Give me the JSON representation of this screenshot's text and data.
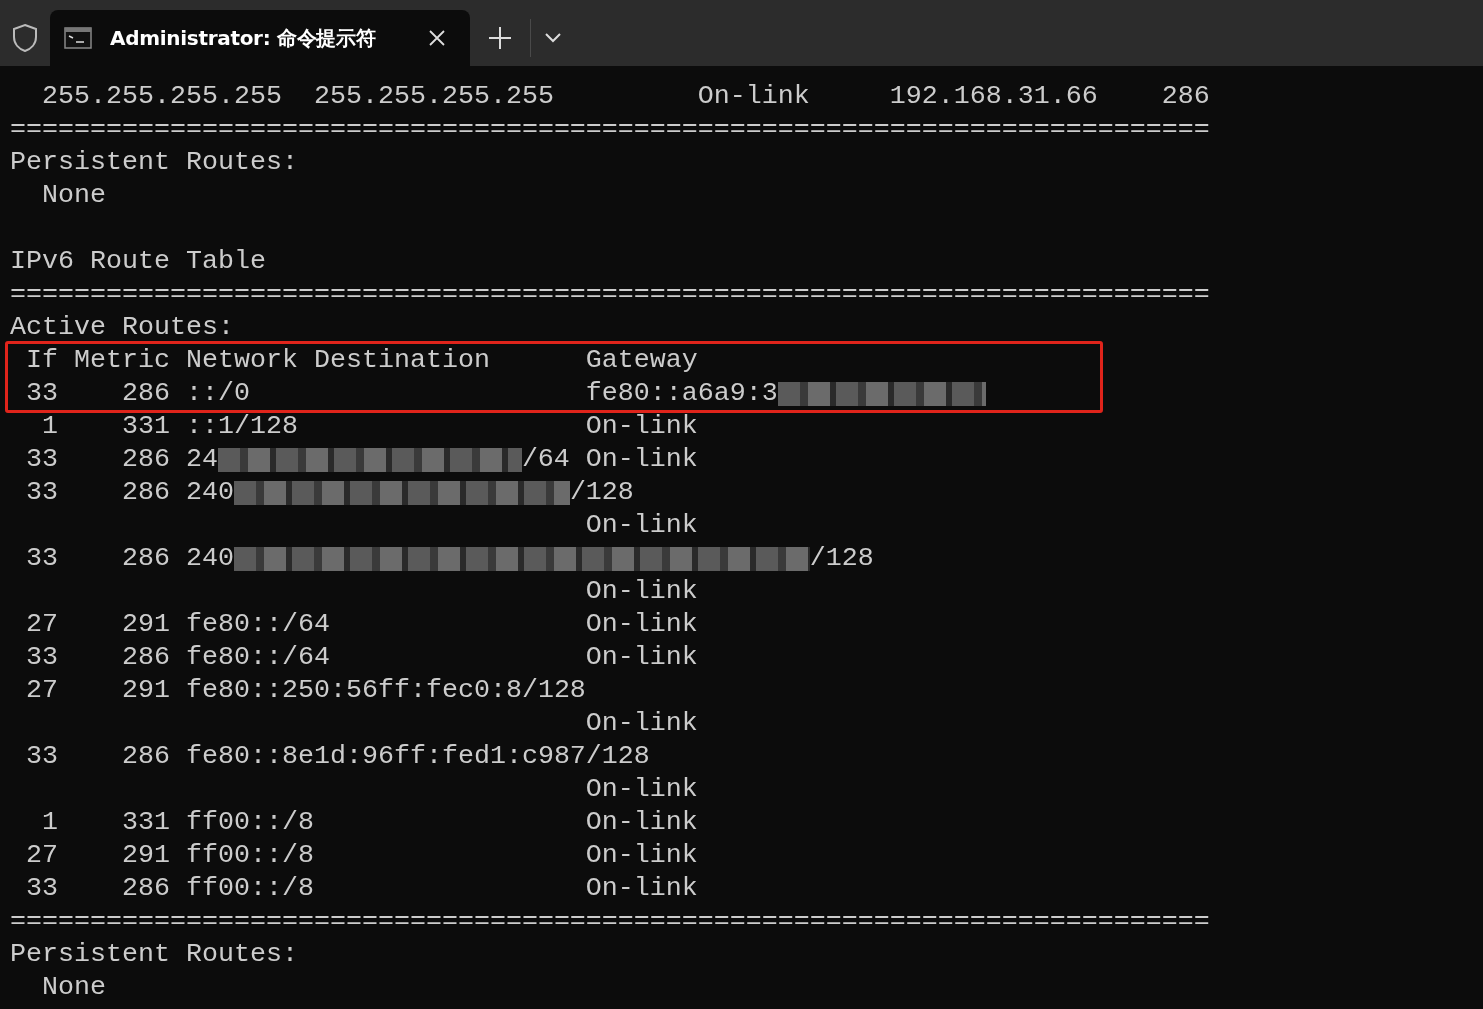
{
  "tab_bar": {
    "tabs": [
      {
        "title": "Administrator: 命令提示符",
        "selected": true
      }
    ]
  },
  "terminal": {
    "blocks": [
      {
        "kind": "plain",
        "lines": [
          {
            "kind": "text",
            "text": "  255.255.255.255  255.255.255.255         On-link     192.168.31.66    286"
          },
          {
            "kind": "text",
            "text": "==========================================================================="
          },
          {
            "kind": "text",
            "text": "Persistent Routes:"
          },
          {
            "kind": "text",
            "text": "  None"
          },
          {
            "kind": "blank"
          },
          {
            "kind": "text",
            "text": "IPv6 Route Table"
          },
          {
            "kind": "text",
            "text": "==========================================================================="
          },
          {
            "kind": "text",
            "text": "Active Routes:"
          }
        ]
      },
      {
        "kind": "highlighted",
        "lines": [
          {
            "kind": "text",
            "text": " If Metric Network Destination      Gateway"
          },
          {
            "kind": "parts",
            "parts": [
              {
                "kind": "text",
                "text": " 33    286 ::/0                     fe80::a6a9:3"
              },
              {
                "kind": "pixelated_short"
              }
            ]
          }
        ]
      },
      {
        "kind": "plain",
        "lines": [
          {
            "kind": "text",
            "text": "  1    331 ::1/128                  On-link"
          },
          {
            "kind": "parts",
            "parts": [
              {
                "kind": "text",
                "text": " 33    286 24"
              },
              {
                "kind": "pixelated_medium"
              },
              {
                "kind": "text",
                "text": "/64 On-link"
              }
            ]
          },
          {
            "kind": "parts",
            "parts": [
              {
                "kind": "text",
                "text": " 33    286 240"
              },
              {
                "kind": "pixelated_long"
              },
              {
                "kind": "text",
                "text": "/128"
              }
            ]
          },
          {
            "kind": "text",
            "text": "                                    On-link"
          },
          {
            "kind": "parts",
            "parts": [
              {
                "kind": "text",
                "text": " 33    286 240"
              },
              {
                "kind": "pixelated_extra_long"
              },
              {
                "kind": "text",
                "text": "/128"
              }
            ]
          },
          {
            "kind": "text",
            "text": "                                    On-link"
          },
          {
            "kind": "text",
            "text": " 27    291 fe80::/64                On-link"
          },
          {
            "kind": "text",
            "text": " 33    286 fe80::/64                On-link"
          },
          {
            "kind": "text",
            "text": " 27    291 fe80::250:56ff:fec0:8/128"
          },
          {
            "kind": "text",
            "text": "                                    On-link"
          },
          {
            "kind": "text",
            "text": " 33    286 fe80::8e1d:96ff:fed1:c987/128"
          },
          {
            "kind": "text",
            "text": "                                    On-link"
          },
          {
            "kind": "text",
            "text": "  1    331 ff00::/8                 On-link"
          },
          {
            "kind": "text",
            "text": " 27    291 ff00::/8                 On-link"
          },
          {
            "kind": "text",
            "text": " 33    286 ff00::/8                 On-link"
          },
          {
            "kind": "text",
            "text": "==========================================================================="
          },
          {
            "kind": "text",
            "text": "Persistent Routes:"
          },
          {
            "kind": "text",
            "text": "  None"
          }
        ]
      }
    ]
  }
}
